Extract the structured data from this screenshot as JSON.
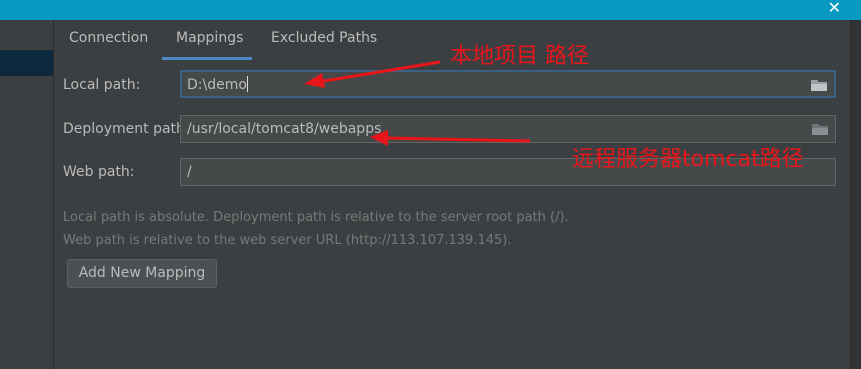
{
  "window": {
    "close_glyph": "✕"
  },
  "tabs": [
    {
      "label": "Connection",
      "active": false
    },
    {
      "label": "Mappings",
      "active": true
    },
    {
      "label": "Excluded Paths",
      "active": false
    }
  ],
  "fields": {
    "local_path": {
      "label": "Local path:",
      "value": "D:\\demo"
    },
    "deployment_path": {
      "label": "Deployment path:",
      "value": "/usr/local/tomcat8/webapps"
    },
    "web_path": {
      "label": "Web path:",
      "value": "/"
    }
  },
  "help": {
    "line1": "Local path is absolute. Deployment path is relative to the server root path (/).",
    "line2": "Web path is relative to the web server URL (http://113.107.139.145)."
  },
  "buttons": {
    "add_mapping": "Add New Mapping"
  },
  "annotations": {
    "local": "本地项目 路径",
    "remote": "远程服务器tomcat路径"
  },
  "colors": {
    "accent": "#4a88c7",
    "annotation_red": "#e8161a",
    "titlebar": "#0899c0"
  },
  "icons": [
    "close-icon",
    "folder-icon"
  ]
}
